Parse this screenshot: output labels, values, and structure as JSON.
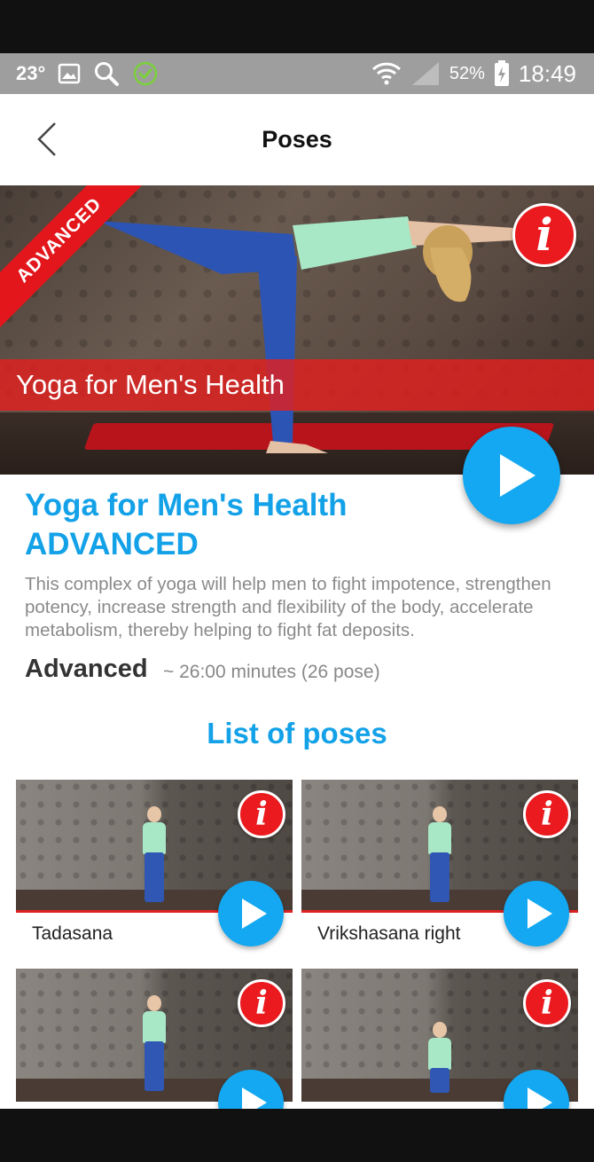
{
  "status_bar": {
    "temperature": "23°",
    "battery": "52%",
    "time": "18:49"
  },
  "app_bar": {
    "title": "Poses"
  },
  "hero": {
    "ribbon": "ADVANCED",
    "banner_text": "Yoga for Men's Health"
  },
  "program": {
    "title_line1": "Yoga for Men's Health",
    "title_line2": "ADVANCED",
    "description": "This complex of yoga will help men to fight impotence, strengthen potency, increase strength and flexibility of the body, accelerate metabolism, thereby helping to fight fat deposits.",
    "level": "Advanced",
    "duration": "~ 26:00 minutes (26 pose)"
  },
  "poses_section": {
    "title": "List of poses",
    "info_glyph": "i",
    "items": [
      {
        "label": "Tadasana"
      },
      {
        "label": "Vrikshasana right"
      },
      {
        "label": ""
      },
      {
        "label": ""
      }
    ]
  },
  "colors": {
    "accent_blue": "#13a1e8",
    "accent_red": "#e3161b"
  }
}
